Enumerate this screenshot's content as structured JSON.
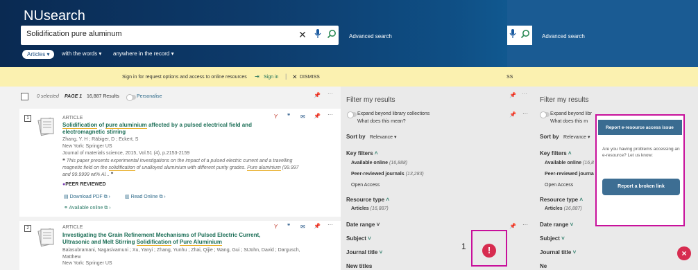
{
  "header": {
    "brand": "NUsearch",
    "query": "Solidification pure aluminum",
    "advanced": "Advanced search",
    "type": "Articles",
    "with_words": "with the words",
    "anywhere": "anywhere in the record",
    "right_advanced": "Advanced search"
  },
  "banner": {
    "message": "Sign in for request options and access to online resources",
    "signin": "Sign in",
    "dismiss": "DISMISS",
    "right_fragment": "SS"
  },
  "results_bar": {
    "selected": "0 selected",
    "page": "PAGE 1",
    "count": "16,887 Results",
    "personalise": "Personalise"
  },
  "results": [
    {
      "num": "1",
      "type": "ARTICLE",
      "title_line1_a": "Solidification",
      "title_line1_b": " of ",
      "title_line1_c": "pure aluminium",
      "title_line1_d": " affected by a pulsed electrical field and",
      "title_line2": "electromagnetic stirring",
      "authors": "Zhang, Y. H ; Räbiger, D ; Eckert, S",
      "publisher": "New York: Springer US",
      "source": "Journal of materials science, 2015, Vol.51 (4), p.2153-2159",
      "snippet_1": "This paper presents experimental investigations on the impact of a pulsed electric current and a travelling",
      "snippet_2a": "magnetic field on the ",
      "snippet_2b": "solidification",
      "snippet_2c": " of unalloyed aluminium with different purity grades. ",
      "snippet_2d": "Pure aluminium",
      "snippet_2e": " (99.997",
      "snippet_3": "and 99.9999 wt% Al...",
      "peer": "PEER REVIEWED",
      "download": "Download PDF",
      "read_online": "Read Online",
      "available": "Available online"
    },
    {
      "num": "2",
      "type": "ARTICLE",
      "title_line1": "Investigating the Grain Refinement Mechanisms of Pulsed Electric Current,",
      "title_line2_a": "Ultrasonic and Melt Stirring ",
      "title_line2_b": "Solidification",
      "title_line2_c": " of ",
      "title_line2_d": "Pure Aluminium",
      "authors_1": "Balasubramani, Nagasivamuni ; Xu, Yanyi ; Zhang, Yunhu ; Zhai, Qijie ; Wang, Gui ; StJohn, David ; Dargusch,",
      "authors_2": "Matthew",
      "publisher": "New York: Springer US"
    }
  ],
  "facets": {
    "heading": "Filter my results",
    "expand": "Expand beyond library collections",
    "what": "What does this mean?",
    "sort_label": "Sort by",
    "sort_value": "Relevance",
    "key_filters": "Key filters",
    "available_online": "Available online",
    "available_online_count": "(16,888)",
    "peer_reviewed": "Peer-reviewed journals",
    "peer_reviewed_count": "(13,283)",
    "open_access": "Open Access",
    "resource_type": "Resource type",
    "articles": "Articles",
    "articles_count": "(16,887)",
    "date_range": "Date range",
    "subject": "Subject",
    "journal_title": "Journal title",
    "new_titles": "New titles"
  },
  "right_facets": {
    "heading": "Filter my results",
    "expand": "Expand beyond libr",
    "what": "What does this m",
    "sort_label": "Sort by",
    "sort_value": "Relevance",
    "key_filters": "Key filters",
    "available_online": "Available online",
    "available_count_frag": "(16,8",
    "peer_reviewed": "Peer-reviewed journa",
    "open_access": "Open Access",
    "resource_type": "Resource type",
    "articles": "Articles",
    "articles_count": "(16,887)",
    "date_range": "Date range",
    "subject": "Subject",
    "journal_title": "Journal title",
    "new_titles": "Ne"
  },
  "popup": {
    "header": "Report e-resource access issue",
    "text": "Are you having problems accessing an e-resource? Let us know:",
    "button": "Report a broken link"
  },
  "feedback": {
    "label": "1",
    "icon": "!"
  },
  "close": "×"
}
